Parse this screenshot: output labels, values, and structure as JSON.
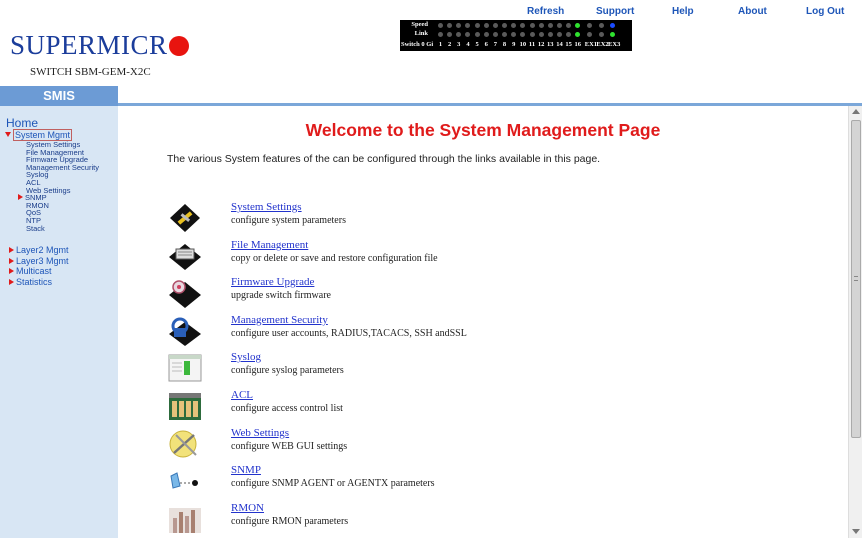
{
  "top_nav": {
    "refresh": "Refresh",
    "support": "Support",
    "help": "Help",
    "about": "About",
    "logout": "Log Out"
  },
  "brand": {
    "logo_text": "SUPERMICR",
    "model": "SWITCH SBM-GEM-X2C",
    "app_name": "SMIS",
    "colors": {
      "logo": "#1b3d9b",
      "logo_dot": "#e8140f",
      "link": "#1e56b8",
      "title": "#e01b1b"
    }
  },
  "led_panel": {
    "speed_label": "Speed",
    "link_label": "Link",
    "switch_label": "Switch 0 Gi",
    "ports": [
      "1",
      "2",
      "3",
      "4",
      "5",
      "6",
      "7",
      "8",
      "9",
      "10",
      "11",
      "12",
      "13",
      "14",
      "15",
      "16",
      "EX1",
      "EX2",
      "EX3"
    ],
    "speed_states": [
      "off",
      "off",
      "off",
      "off",
      "off",
      "off",
      "off",
      "off",
      "off",
      "off",
      "off",
      "off",
      "off",
      "off",
      "off",
      "green",
      "off",
      "off",
      "blue"
    ],
    "link_states": [
      "off",
      "off",
      "off",
      "off",
      "off",
      "off",
      "off",
      "off",
      "off",
      "off",
      "off",
      "off",
      "off",
      "off",
      "off",
      "green",
      "off",
      "off",
      "green"
    ]
  },
  "sidebar": {
    "home": "Home",
    "system_mgmt": "System Mgmt",
    "sub_items": [
      "System Settings",
      "File Management",
      "Firmware Upgrade",
      "Management Security",
      "Syslog",
      "ACL",
      "Web Settings",
      "SNMP",
      "RMON",
      "QoS",
      "NTP",
      "Stack"
    ],
    "groups": [
      "Layer2 Mgmt",
      "Layer3 Mgmt",
      "Multicast",
      "Statistics"
    ]
  },
  "main": {
    "title": "Welcome to the System Management Page",
    "description": "The various System features of the can be configured through the links available in this page.",
    "features": [
      {
        "link": "System Settings",
        "desc": "configure system parameters",
        "icon": "tools-icon"
      },
      {
        "link": "File Management",
        "desc": "copy or delete or save and restore configuration file",
        "icon": "file-device-icon"
      },
      {
        "link": "Firmware Upgrade",
        "desc": "upgrade switch firmware",
        "icon": "firmware-chip-icon"
      },
      {
        "link": "Management Security",
        "desc": "configure user accounts, RADIUS,TACACS, SSH andSSL",
        "icon": "lock-key-icon"
      },
      {
        "link": "Syslog",
        "desc": "configure syslog parameters",
        "icon": "log-window-icon"
      },
      {
        "link": "ACL",
        "desc": "configure access control list",
        "icon": "building-icon"
      },
      {
        "link": "Web Settings",
        "desc": "configure WEB GUI settings",
        "icon": "web-tools-icon"
      },
      {
        "link": "SNMP",
        "desc": "configure SNMP AGENT or AGENTX parameters",
        "icon": "snmp-agent-icon"
      },
      {
        "link": "RMON",
        "desc": "configure RMON parameters",
        "icon": "rmon-chart-icon"
      }
    ]
  }
}
